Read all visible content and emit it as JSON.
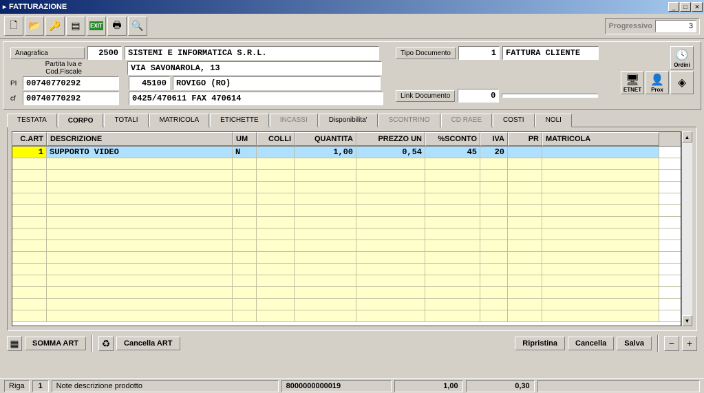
{
  "window": {
    "title": "FATTURAZIONE"
  },
  "progressivo": {
    "label": "Progressivo",
    "value": "3"
  },
  "header": {
    "anagrafica_label": "Anagrafica",
    "anagrafica_code": "2500",
    "company_name": "SISTEMI E INFORMATICA S.R.L.",
    "partita_label": "Partita Iva e Cod.Fiscale",
    "address": "VIA SAVONAROLA, 13",
    "pi_label": "PI",
    "pi": "00740770292",
    "cap": "45100",
    "city": "ROVIGO (RO)",
    "cf_label": "cf",
    "cf": "00740770292",
    "phone": "0425/470611 FAX 470614",
    "tipo_doc_label": "Tipo Documento",
    "tipo_doc_code": "1",
    "tipo_doc_name": "FATTURA CLIENTE",
    "link_doc_label": "Link Documento",
    "link_doc_value": "0",
    "ordini_label": "Ordini",
    "etnet_label": "ETNET",
    "prox_label": "Prox"
  },
  "tabs": [
    {
      "label": "TESTATA",
      "active": false,
      "disabled": false
    },
    {
      "label": "CORPO",
      "active": true,
      "disabled": false
    },
    {
      "label": "TOTALI",
      "active": false,
      "disabled": false
    },
    {
      "label": "MATRICOLA",
      "active": false,
      "disabled": false
    },
    {
      "label": "ETICHETTE",
      "active": false,
      "disabled": false
    },
    {
      "label": "INCASSI",
      "active": false,
      "disabled": true
    },
    {
      "label": "Disponibilita'",
      "active": false,
      "disabled": false
    },
    {
      "label": "SCONTRINO",
      "active": false,
      "disabled": true
    },
    {
      "label": "CD RAEE",
      "active": false,
      "disabled": true
    },
    {
      "label": "COSTI",
      "active": false,
      "disabled": false
    },
    {
      "label": "NOLI",
      "active": false,
      "disabled": false
    }
  ],
  "grid": {
    "columns": [
      "C.ART",
      "DESCRIZIONE",
      "UM",
      "COLLI",
      "QUANTITA",
      "PREZZO UN",
      "%SCONTO",
      "IVA",
      "PR",
      "MATRICOLA"
    ],
    "rows": [
      {
        "cart": "1",
        "descrizione": "SUPPORTO VIDEO",
        "um": "N",
        "colli": "",
        "quantita": "1,00",
        "prezzo": "0,54",
        "sconto": "45",
        "iva": "20",
        "pr": "",
        "matricola": ""
      }
    ]
  },
  "footer": {
    "somma_art": "SOMMA ART",
    "cancella_art": "Cancella ART",
    "ripristina": "Ripristina",
    "cancella": "Cancella",
    "salva": "Salva"
  },
  "status": {
    "riga_label": "Riga",
    "riga_value": "1",
    "note_placeholder": "Note descrizione prodotto",
    "barcode": "8000000000019",
    "val1": "1,00",
    "val2": "0,30"
  }
}
